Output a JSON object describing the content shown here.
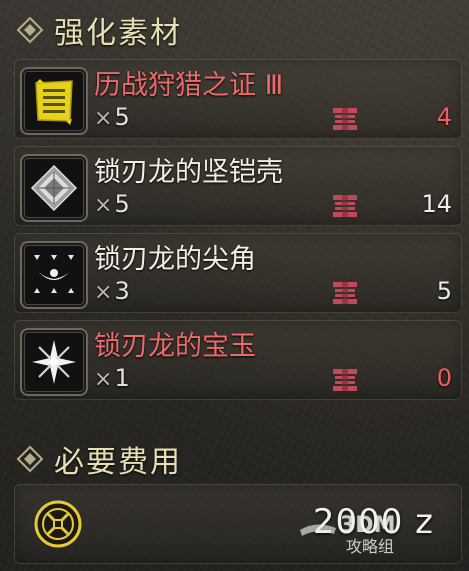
{
  "materials_header": {
    "title": "强化素材"
  },
  "materials": [
    {
      "name": "历战狩猎之证 Ⅲ",
      "required": "5",
      "owned": "4",
      "icon": "yellow-ticket-icon",
      "name_color": "#ee6a6a",
      "owned_short": true
    },
    {
      "name": "锁刃龙的坚铠壳",
      "required": "5",
      "owned": "14",
      "icon": "shell-icon",
      "name_color": "#f2efe6",
      "owned_short": false
    },
    {
      "name": "锁刃龙的尖角",
      "required": "3",
      "owned": "5",
      "icon": "horn-icon",
      "name_color": "#f2efe6",
      "owned_short": false
    },
    {
      "name": "锁刃龙的宝玉",
      "required": "1",
      "owned": "0",
      "icon": "gem-icon",
      "name_color": "#ee6a6a",
      "owned_short": true
    }
  ],
  "quantity_prefix": "×",
  "cost_header": {
    "title": "必要费用"
  },
  "cost": {
    "value": "2000 z",
    "icon": "zenny-coin-icon"
  },
  "watermark": {
    "line1": "3DM",
    "line2": "攻略组"
  },
  "colors": {
    "rare_text": "#ee6a6a",
    "short_count": "#ef5f5f",
    "header_text": "#e8dfb4",
    "box_icon": "#c04a5a",
    "accent_yellow": "#e6d21a"
  }
}
